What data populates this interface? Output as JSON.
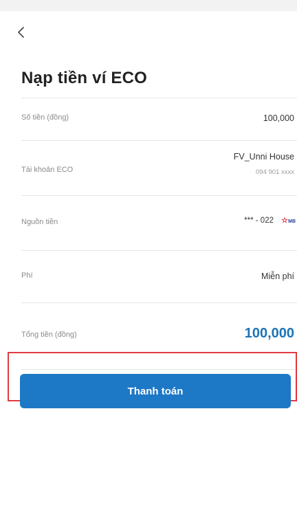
{
  "header": {
    "title": "Nạp tiền ví ECO"
  },
  "details": {
    "amount_label": "Số tiền (đồng)",
    "amount_value": "100,000",
    "account_label": "Tài khoản ECO",
    "account_name": "FV_Unni House",
    "account_phone": "094 901 xxxx",
    "source_label": "Nguồn tiền",
    "source_value": "*** - 022",
    "source_bank": "MB",
    "fee_label": "Phí",
    "fee_value": "Miễn phí",
    "total_label": "Tổng tiền (đồng)",
    "total_value": "100,000"
  },
  "actions": {
    "pay_label": "Thanh toán"
  },
  "colors": {
    "accent": "#1d78c6",
    "total_text": "#1c73b7",
    "highlight_border": "#e03a3f",
    "bank_star": "#e0282e",
    "bank_text": "#1f3f96"
  }
}
